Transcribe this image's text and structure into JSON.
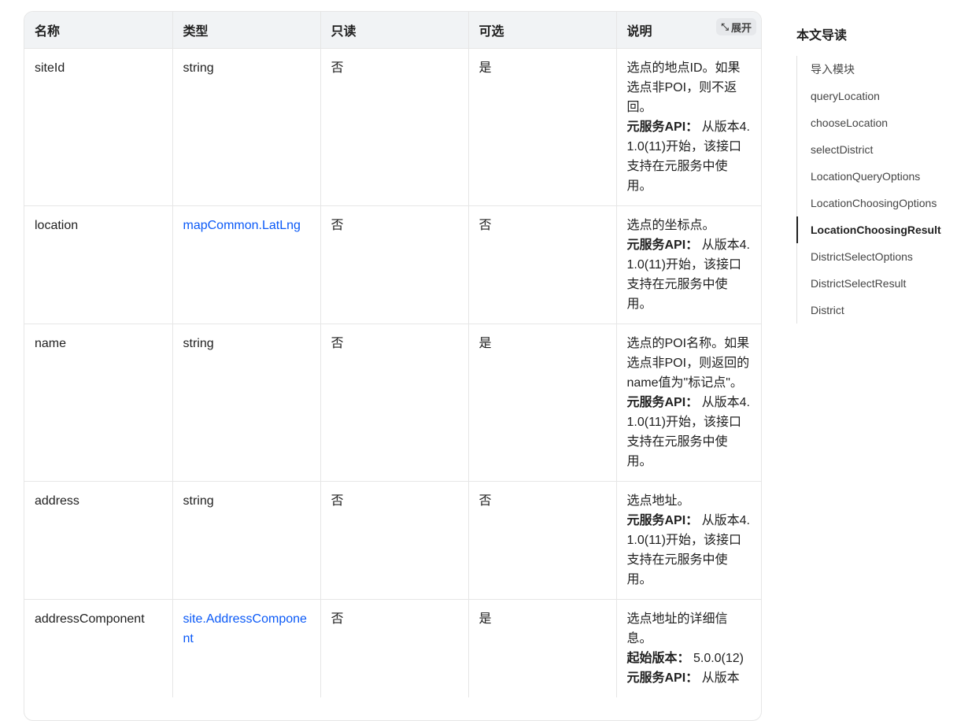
{
  "table": {
    "headers": [
      "名称",
      "类型",
      "只读",
      "可选",
      "说明"
    ],
    "expand_label": "展开",
    "rows": [
      {
        "name": "siteId",
        "type": "string",
        "type_link": false,
        "readonly": "否",
        "optional": "是",
        "desc": "选点的地点ID。如果选点非POI，则不返回。",
        "meta": [
          {
            "label": "元服务API：",
            "value": "从版本4.1.0(11)开始，该接口支持在元服务中使用。"
          }
        ]
      },
      {
        "name": "location",
        "type": "mapCommon.LatLng",
        "type_link": true,
        "readonly": "否",
        "optional": "否",
        "desc": "选点的坐标点。",
        "meta": [
          {
            "label": "元服务API：",
            "value": "从版本4.1.0(11)开始，该接口支持在元服务中使用。"
          }
        ]
      },
      {
        "name": "name",
        "type": "string",
        "type_link": false,
        "readonly": "否",
        "optional": "是",
        "desc": "选点的POI名称。如果选点非POI，则返回的name值为\"标记点\"。",
        "meta": [
          {
            "label": "元服务API：",
            "value": "从版本4.1.0(11)开始，该接口支持在元服务中使用。"
          }
        ]
      },
      {
        "name": "address",
        "type": "string",
        "type_link": false,
        "readonly": "否",
        "optional": "否",
        "desc": "选点地址。",
        "meta": [
          {
            "label": "元服务API：",
            "value": "从版本4.1.0(11)开始，该接口支持在元服务中使用。"
          }
        ]
      },
      {
        "name": "addressComponent",
        "type": "site.AddressComponent",
        "type_link": true,
        "readonly": "否",
        "optional": "是",
        "desc": "选点地址的详细信息。",
        "meta": [
          {
            "label": "起始版本：",
            "value": "5.0.0(12)"
          },
          {
            "label": "元服务API：",
            "value": "从版本"
          }
        ]
      }
    ]
  },
  "toc": {
    "title": "本文导读",
    "items": [
      "导入模块",
      "queryLocation",
      "chooseLocation",
      "selectDistrict",
      "LocationQueryOptions",
      "LocationChoosingOptions",
      "LocationChoosingResult",
      "DistrictSelectOptions",
      "DistrictSelectResult",
      "District"
    ],
    "active_index": 6
  }
}
